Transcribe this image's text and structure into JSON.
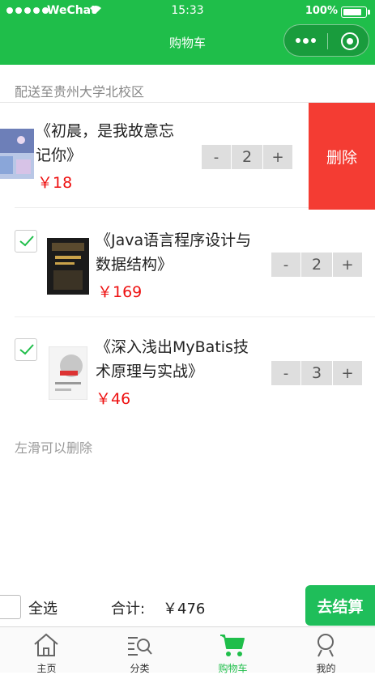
{
  "status_bar": {
    "carrier": "WeChat",
    "time": "15:33",
    "battery": "100%"
  },
  "nav": {
    "title": "购物车"
  },
  "address": "配送至贵州大学北校区",
  "items": [
    {
      "title_line1": "《初晨，是我故意忘",
      "title_line2": "记你》",
      "price": "￥18",
      "qty": "2",
      "checked": true,
      "swiped": true
    },
    {
      "title_line1": "《Java语言程序设计与",
      "title_line2": "数据结构》",
      "price": "￥169",
      "qty": "2",
      "checked": true,
      "swiped": false
    },
    {
      "title_line1": "《深入浅出MyBatis技",
      "title_line2": "术原理与实战》",
      "price": "￥46",
      "qty": "3",
      "checked": true,
      "swiped": false
    }
  ],
  "stepper": {
    "minus": "-",
    "plus": "+"
  },
  "delete_label": "删除",
  "hint": "左滑可以删除",
  "checkout": {
    "select_all": "全选",
    "total_label": "合计:",
    "total_value": "￥476",
    "pay_label": "去结算"
  },
  "tabbar": [
    {
      "label": "主页",
      "icon": "home-icon"
    },
    {
      "label": "分类",
      "icon": "category-search-icon"
    },
    {
      "label": "购物车",
      "icon": "cart-icon",
      "active": true
    },
    {
      "label": "我的",
      "icon": "profile-icon"
    }
  ],
  "colors": {
    "brand_green": "#1fbe4a",
    "delete_red": "#f43c33",
    "price_red": "#ee1111"
  }
}
